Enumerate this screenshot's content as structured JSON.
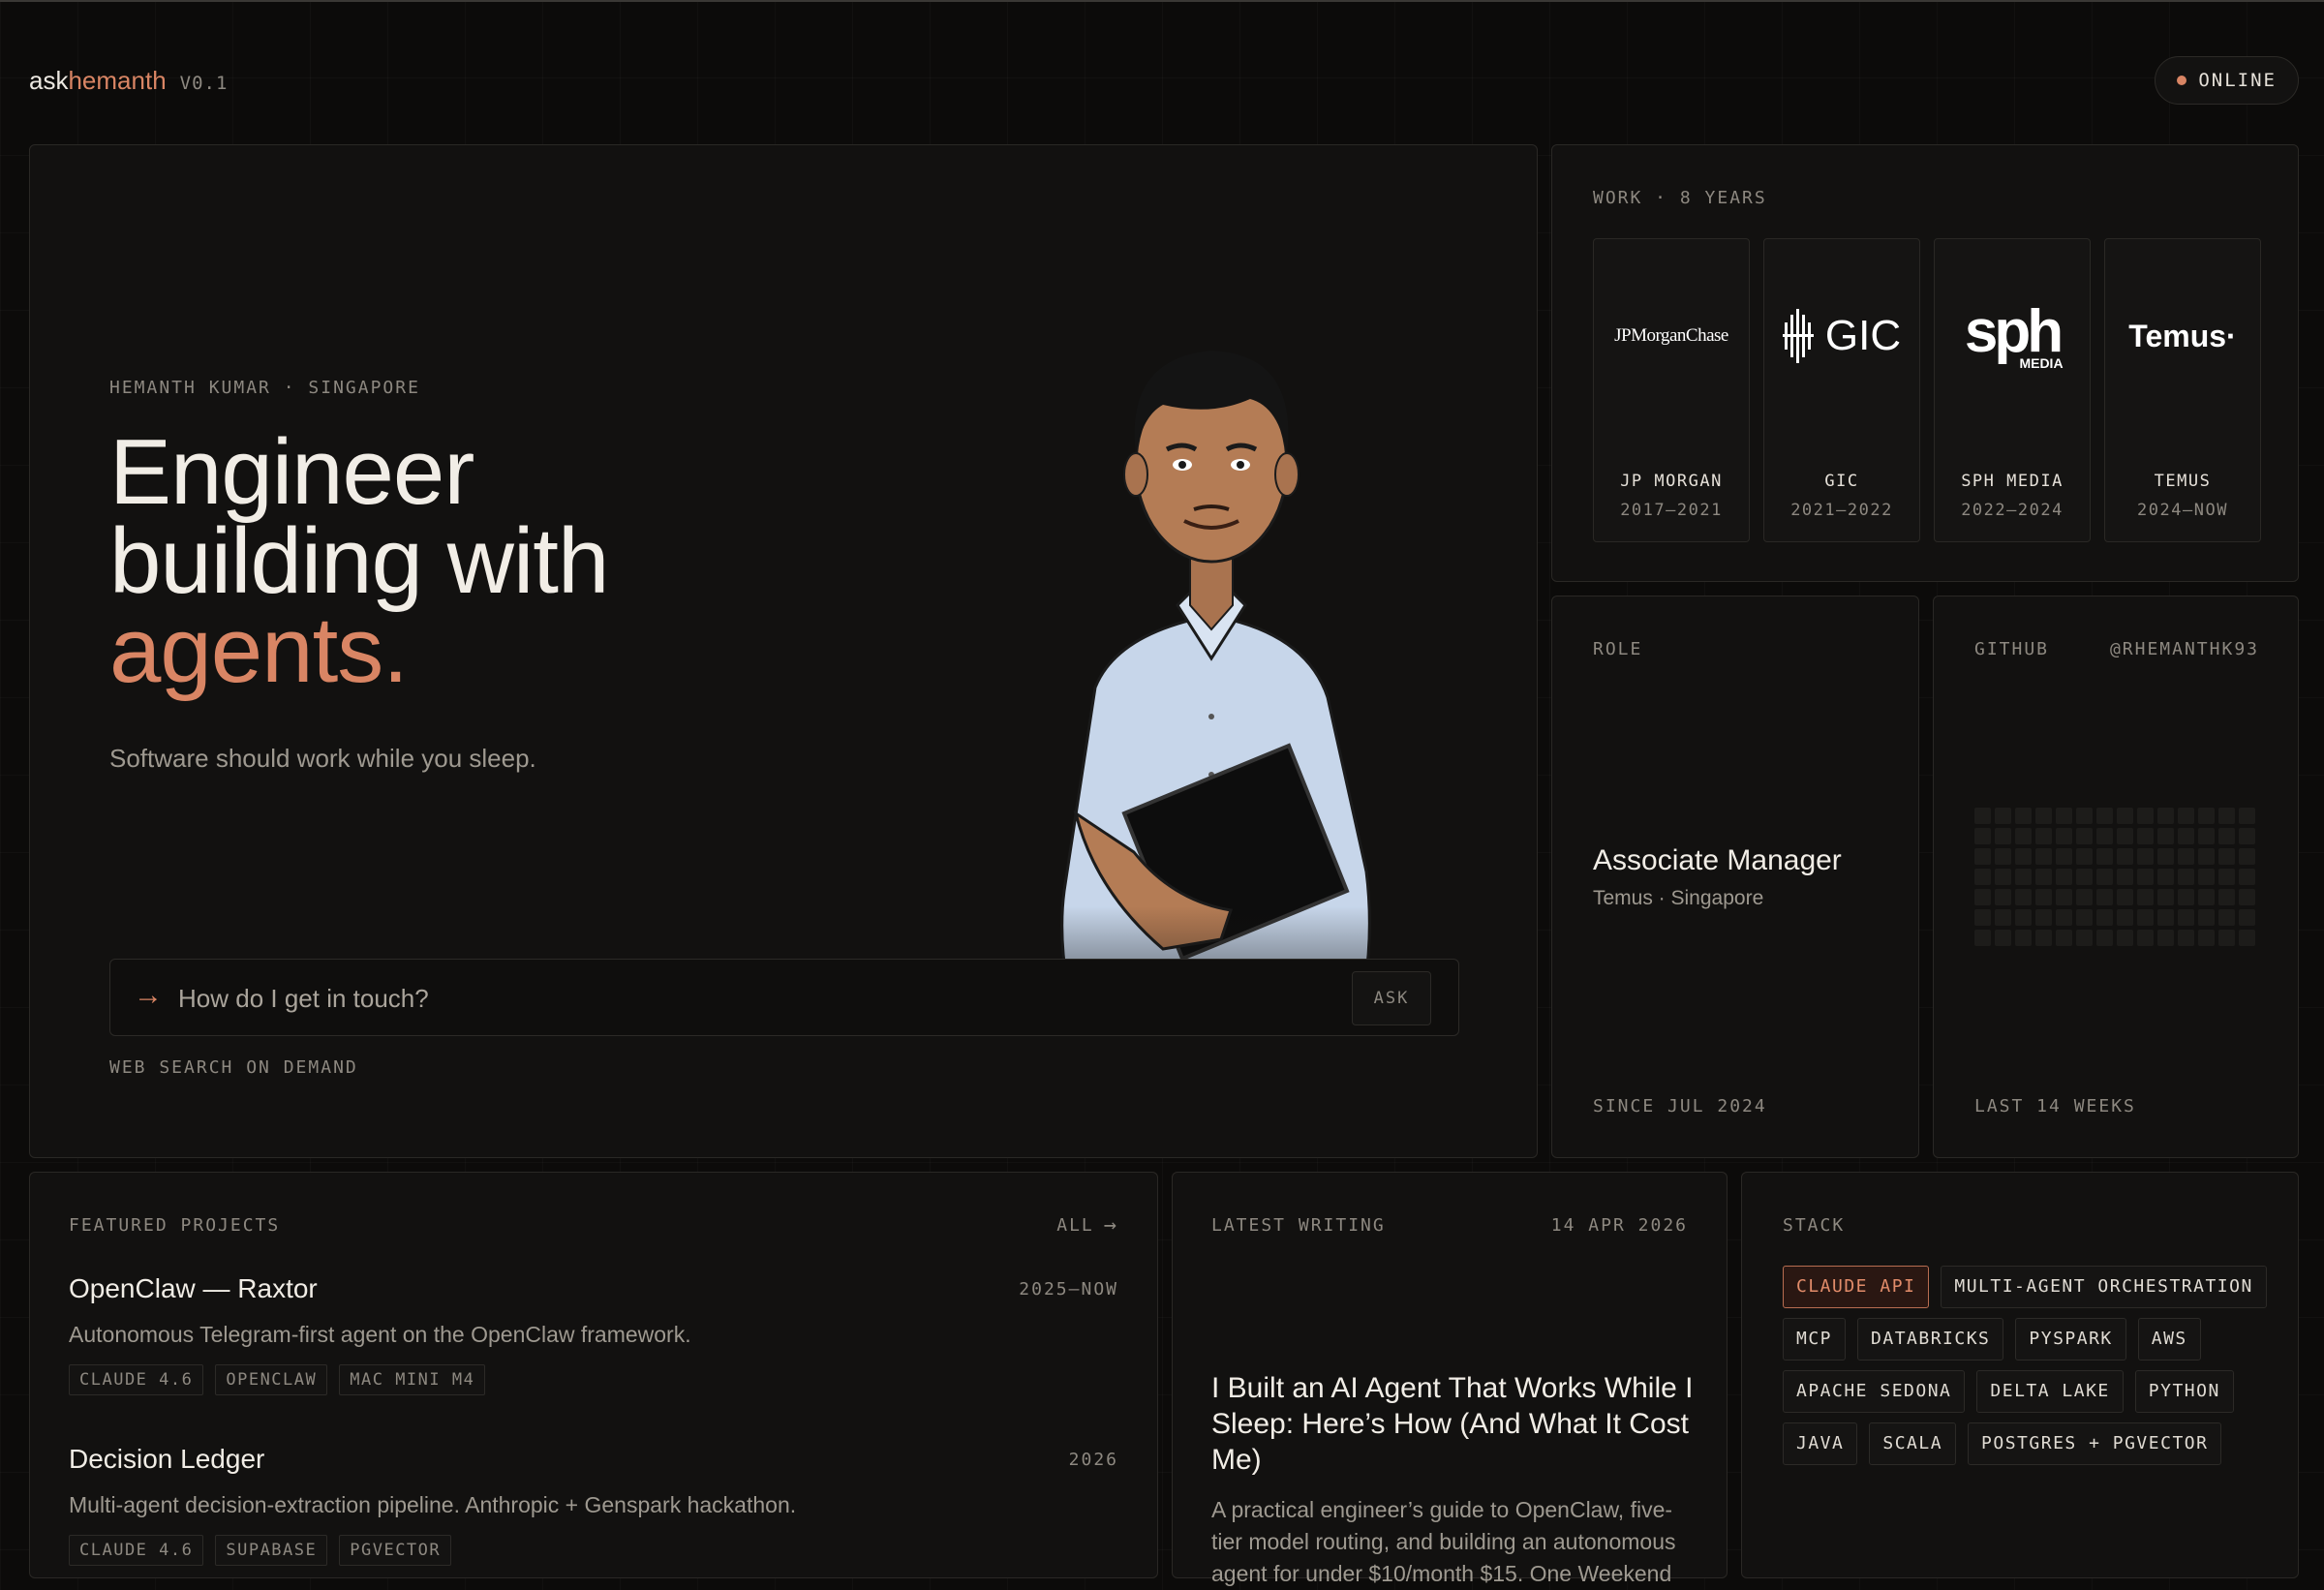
{
  "brand": {
    "part1": "ask",
    "part2": "hemanth",
    "version": "V0.1"
  },
  "status": {
    "label": "ONLINE",
    "color": "#d98564"
  },
  "hero": {
    "kicker": "HEMANTH KUMAR · SINGAPORE",
    "headline_line1": "Engineer",
    "headline_line2": "building with",
    "headline_accent": "agents.",
    "subtitle": "Software should work while you sleep.",
    "ask_placeholder": "How do I get in touch?",
    "ask_button": "ASK",
    "note": "WEB SEARCH ON DEMAND",
    "accent_color": "#d98564"
  },
  "work": {
    "kicker": "WORK · 8 YEARS",
    "companies": [
      {
        "logo_text": "JPMorganChase",
        "name": "JP MORGAN",
        "years": "2017–2021"
      },
      {
        "logo_text": "GIC",
        "name": "GIC",
        "years": "2021–2022"
      },
      {
        "logo_text": "sph",
        "logo_sub": "MEDIA",
        "name": "SPH MEDIA",
        "years": "2022–2024"
      },
      {
        "logo_text": "Temus",
        "name": "TEMUS",
        "years": "2024–NOW"
      }
    ]
  },
  "role": {
    "kicker": "ROLE",
    "title": "Associate Manager",
    "where": "Temus · Singapore",
    "since": "SINCE JUL 2024"
  },
  "github": {
    "kicker": "GITHUB",
    "handle": "@RHEMANTHK93",
    "footer": "LAST 14 WEEKS"
  },
  "projects": {
    "kicker": "FEATURED PROJECTS",
    "all_label": "ALL",
    "items": [
      {
        "name": "OpenClaw — Raxtor",
        "years": "2025–NOW",
        "desc": "Autonomous Telegram-first agent on the OpenClaw framework.",
        "tags": [
          "CLAUDE 4.6",
          "OPENCLAW",
          "MAC MINI M4"
        ]
      },
      {
        "name": "Decision Ledger",
        "years": "2026",
        "desc": "Multi-agent decision-extraction pipeline. Anthropic + Genspark hackathon.",
        "tags": [
          "CLAUDE 4.6",
          "SUPABASE",
          "PGVECTOR"
        ]
      }
    ]
  },
  "writing": {
    "kicker": "LATEST WRITING",
    "date": "14 APR 2026",
    "title": "I Built an AI Agent That Works While I Sleep: Here’s How (And What It Cost Me)",
    "desc": "A practical engineer’s guide to OpenClaw, five-tier model routing, and building an autonomous agent for under $10/month $15. One Weekend"
  },
  "stack": {
    "kicker": "STACK",
    "chips": [
      "CLAUDE API",
      "MULTI-AGENT ORCHESTRATION",
      "MCP",
      "DATABRICKS",
      "PYSPARK",
      "AWS",
      "APACHE SEDONA",
      "DELTA LAKE",
      "PYTHON",
      "JAVA",
      "SCALA",
      "POSTGRES + PGVECTOR"
    ],
    "highlight": "CLAUDE API"
  }
}
